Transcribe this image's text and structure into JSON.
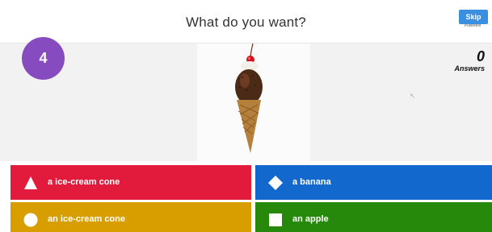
{
  "header": {
    "question": "What do you want?",
    "brand_text": "Pulsetest"
  },
  "stage": {
    "timer_value": "4",
    "skip_label": "Skip",
    "answers_count": "0",
    "answers_label": "Answers",
    "image_subject": "ice-cream cone with chocolate, sprinkles and a cherry"
  },
  "answers": [
    {
      "label": "a ice-cream cone",
      "shape": "triangle-icon",
      "color": "#e21b3c"
    },
    {
      "label": "a banana",
      "shape": "diamond-icon",
      "color": "#1368ce"
    },
    {
      "label": "an ice-cream cone",
      "shape": "circle-icon",
      "color": "#d89e00"
    },
    {
      "label": "an apple",
      "shape": "square-icon",
      "color": "#26890c"
    }
  ]
}
